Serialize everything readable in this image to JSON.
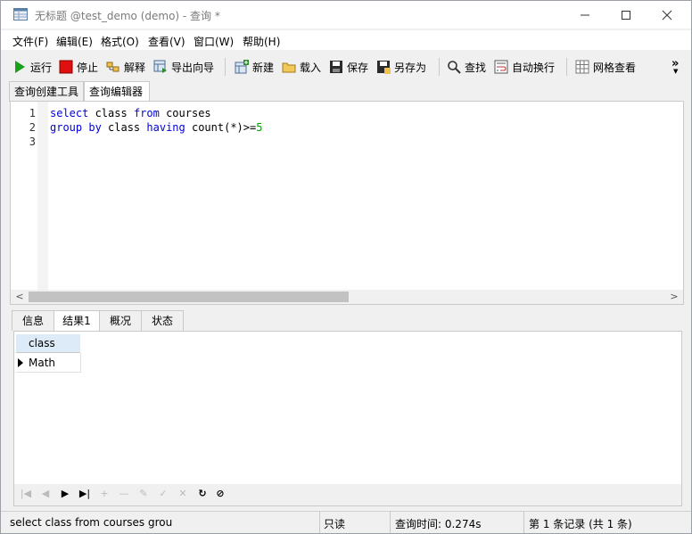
{
  "window": {
    "title": "无标题 @test_demo (demo) - 查询 *",
    "buttons": {
      "minimize": "—",
      "maximize": "☐",
      "close": "✕"
    }
  },
  "menu": [
    "文件(F)",
    "编辑(E)",
    "格式(O)",
    "查看(V)",
    "窗口(W)",
    "帮助(H)"
  ],
  "toolbar": {
    "run": "运行",
    "stop": "停止",
    "explain": "解释",
    "export_wizard": "导出向导",
    "new": "新建",
    "load": "载入",
    "save": "保存",
    "save_as": "另存为",
    "find": "查找",
    "word_wrap": "自动换行",
    "grid_view": "网格查看",
    "more": "»"
  },
  "editor_tabs": [
    "查询创建工具",
    "查询编辑器"
  ],
  "editor": {
    "line_numbers": [
      "1",
      "2",
      "3"
    ],
    "lines": [
      {
        "tokens": [
          {
            "t": "select",
            "k": "kw"
          },
          {
            "t": " class ",
            "k": ""
          },
          {
            "t": "from",
            "k": "kw"
          },
          {
            "t": " courses",
            "k": ""
          }
        ]
      },
      {
        "tokens": [
          {
            "t": "group",
            "k": "kw"
          },
          {
            "t": " ",
            "k": ""
          },
          {
            "t": "by",
            "k": "kw"
          },
          {
            "t": " class ",
            "k": ""
          },
          {
            "t": "having",
            "k": "kw"
          },
          {
            "t": " count(*)>=",
            "k": ""
          },
          {
            "t": "5",
            "k": "num"
          }
        ]
      },
      {
        "tokens": []
      }
    ]
  },
  "result_tabs": [
    "信息",
    "结果1",
    "概况",
    "状态"
  ],
  "result": {
    "columns": [
      "class"
    ],
    "rows": [
      [
        "Math"
      ]
    ]
  },
  "status": {
    "sql": "select class from courses grou",
    "mode": "只读",
    "query_time": "查询时间: 0.274s",
    "records": "第 1 条记录 (共 1 条)"
  },
  "colors": {
    "keyword": "#0000e0",
    "number": "#00a000",
    "run_icon": "#1aa01a",
    "stop_icon": "#e01010"
  }
}
